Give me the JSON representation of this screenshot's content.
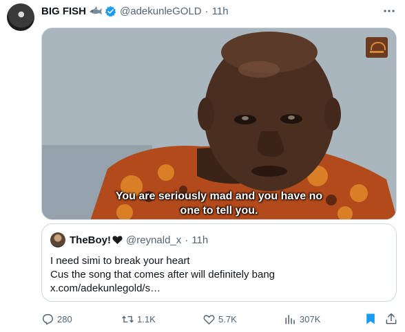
{
  "tweet": {
    "author_name": "BIG FISH",
    "author_handle": "@adekunleGOLD",
    "separator": "·",
    "time": "11h",
    "media_caption_line1": "You are seriously mad and you have no",
    "media_caption_line2": "one to tell you."
  },
  "quoted": {
    "author_name": "TheBoy!",
    "author_handle": "@reynald_x",
    "separator": "·",
    "time": "11h",
    "line1": "I need simi to break your heart",
    "line2": "Cus the song that comes after will definitely bang",
    "line3": "x.com/adekunlegold/s…"
  },
  "actions": {
    "replies": "280",
    "reposts": "1.1K",
    "likes": "5.7K",
    "views": "307K"
  },
  "colors": {
    "text": "#0f1419",
    "secondary": "#536471",
    "verified": "#1d9bf0",
    "bookmark": "#1d9bf0",
    "border": "#cfd9de"
  }
}
